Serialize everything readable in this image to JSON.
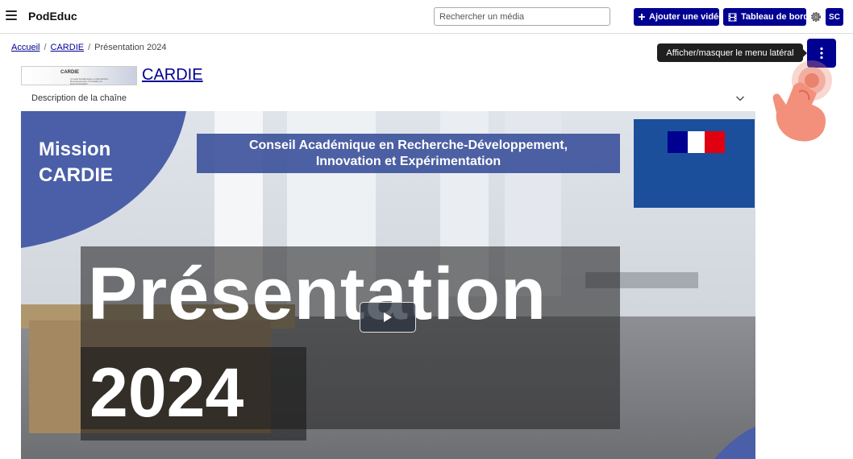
{
  "header": {
    "brand": "PodEduc",
    "search": {
      "placeholder": "Rechercher un média",
      "value": ""
    },
    "add_video_label": "Ajouter une vidéo",
    "dashboard_label": "Tableau de bord",
    "avatar_initials": "SC"
  },
  "breadcrumb": {
    "items": [
      "Accueil",
      "CARDIE",
      "Présentation 2024"
    ],
    "separator": "/"
  },
  "sidebar_toggle": {
    "tooltip": "Afficher/masquer le menu latéral"
  },
  "channel": {
    "logo_text": "CARDIE",
    "logo_subtext": "Conseil Académique en Recherche-Développement, Innovation et Expérimentation",
    "title": "CARDIE",
    "description_label": "Description de la chaîne"
  },
  "video": {
    "mission_line1": "Mission",
    "mission_line2": "CARDIE",
    "conseil_line1": "Conseil Académique en Recherche-Développement,",
    "conseil_line2": "Innovation et Expérimentation",
    "title_word": "Présentation",
    "year": "2024"
  },
  "colors": {
    "primary": "#000091",
    "link": "#000091",
    "tooltip_bg": "#1f1f1f",
    "video_banner": "#3e549c"
  },
  "icons": {
    "menu": "hamburger-icon",
    "add": "plus-icon",
    "dashboard": "film-icon",
    "settings": "gear-icon",
    "toggle": "vertical-dots-icon",
    "expand": "chevron-down-icon",
    "play": "play-icon"
  }
}
